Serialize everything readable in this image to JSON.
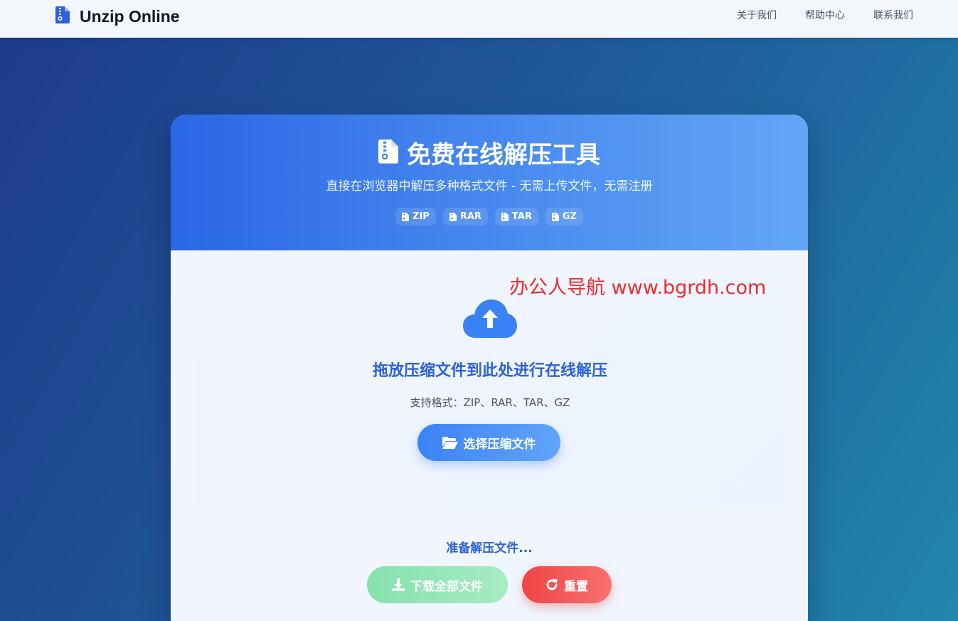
{
  "brand": {
    "title": "Unzip Online",
    "icon": "file-zipper-icon"
  },
  "nav": [
    {
      "label": "关于我们"
    },
    {
      "label": "帮助中心"
    },
    {
      "label": "联系我们"
    }
  ],
  "header": {
    "title": "免费在线解压工具",
    "subtitle": "直接在浏览器中解压多种格式文件 - 无需上传文件，无需注册",
    "formats": [
      "ZIP",
      "RAR",
      "TAR",
      "GZ"
    ]
  },
  "dropzone": {
    "icon": "cloud-upload-icon",
    "title": "拖放压缩文件到此处进行在线解压",
    "formats_text": "支持格式：ZIP、RAR、TAR、GZ",
    "select_label": "选择压缩文件"
  },
  "status": {
    "text": "准备解压文件..."
  },
  "actions": {
    "download_label": "下载全部文件",
    "reset_label": "重置"
  },
  "watermark": {
    "text": "办公人导航 www.bgrdh.com"
  },
  "colors": {
    "primary": "#2b62d9",
    "header_gradient_start": "#2a67e6",
    "header_gradient_end": "#62a6f6",
    "danger": "#ef4444",
    "success": "#86e1ad"
  }
}
